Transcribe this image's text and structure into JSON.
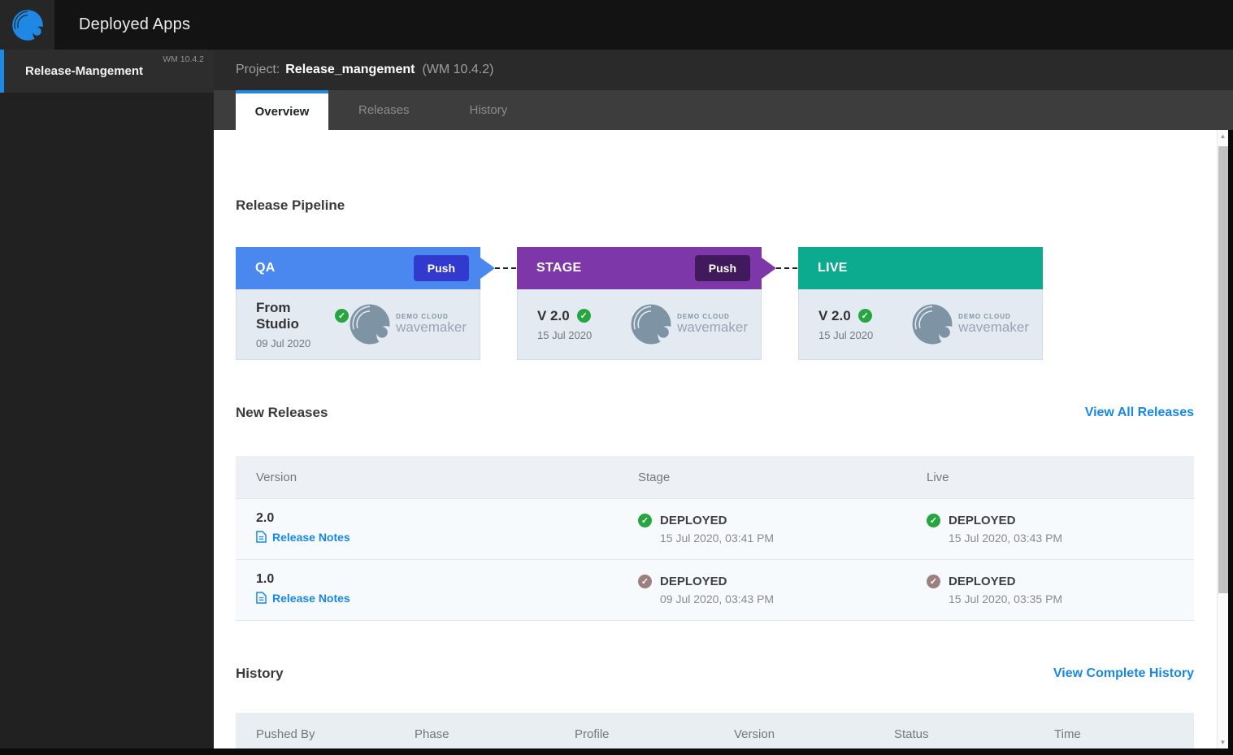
{
  "topbar": {
    "app_title": "Deployed Apps"
  },
  "sidebar": {
    "selected_project": {
      "name": "Release-Mangement",
      "wm_version": "WM 10.4.2"
    }
  },
  "project_header": {
    "prefix": "Project:",
    "name": "Release_mangement",
    "wm_version": "(WM 10.4.2)"
  },
  "tabs": {
    "overview": "Overview",
    "releases": "Releases",
    "history": "History"
  },
  "pipeline": {
    "title": "Release Pipeline",
    "phases": [
      {
        "name": "QA",
        "push_label": "Push",
        "version": "From Studio",
        "date": "09 Jul 2020"
      },
      {
        "name": "STAGE",
        "push_label": "Push",
        "version": "V 2.0",
        "date": "15 Jul 2020"
      },
      {
        "name": "LIVE",
        "version": "V 2.0",
        "date": "15 Jul 2020"
      }
    ],
    "cloud_logo": {
      "line1": "DEMO CLOUD",
      "line2": "wavemaker"
    }
  },
  "new_releases": {
    "title": "New Releases",
    "view_all_label": "View All Releases",
    "columns": [
      "Version",
      "Stage",
      "Live"
    ],
    "rows": [
      {
        "version": "2.0",
        "notes_label": "Release Notes",
        "stage": {
          "status": "DEPLOYED",
          "time": "15 Jul 2020, 03:41 PM"
        },
        "live": {
          "status": "DEPLOYED",
          "time": "15 Jul 2020, 03:43 PM"
        }
      },
      {
        "version": "1.0",
        "notes_label": "Release Notes",
        "stage": {
          "status": "DEPLOYED",
          "time": "09 Jul 2020, 03:43 PM"
        },
        "live": {
          "status": "DEPLOYED",
          "time": "15 Jul 2020, 03:35 PM"
        }
      }
    ]
  },
  "history": {
    "title": "History",
    "view_all_label": "View Complete History",
    "columns": [
      "Pushed By",
      "Phase",
      "Profile",
      "Version",
      "Status",
      "Time"
    ]
  },
  "icons": {
    "check": "✓",
    "scroll_up": "▲",
    "scroll_down": "▼"
  },
  "colors": {
    "accent_blue": "#1e88e5",
    "link_blue": "#1787e8",
    "qa_header": "#4a87ee",
    "qa_push": "#3239cf",
    "stage_header": "#7d37a9",
    "stage_push": "#401a5c",
    "live_header": "#0caa8e",
    "green_check": "#26a63f",
    "muted_check": "#9c8080",
    "topbar": "#131313",
    "sidebar": "#212121",
    "project_header": "#2a2a2a",
    "tabstrip": "#3d3d3d",
    "card_body": "#e4eaf2",
    "table_header": "#edf1f5",
    "table_row": "#f7fafd"
  }
}
